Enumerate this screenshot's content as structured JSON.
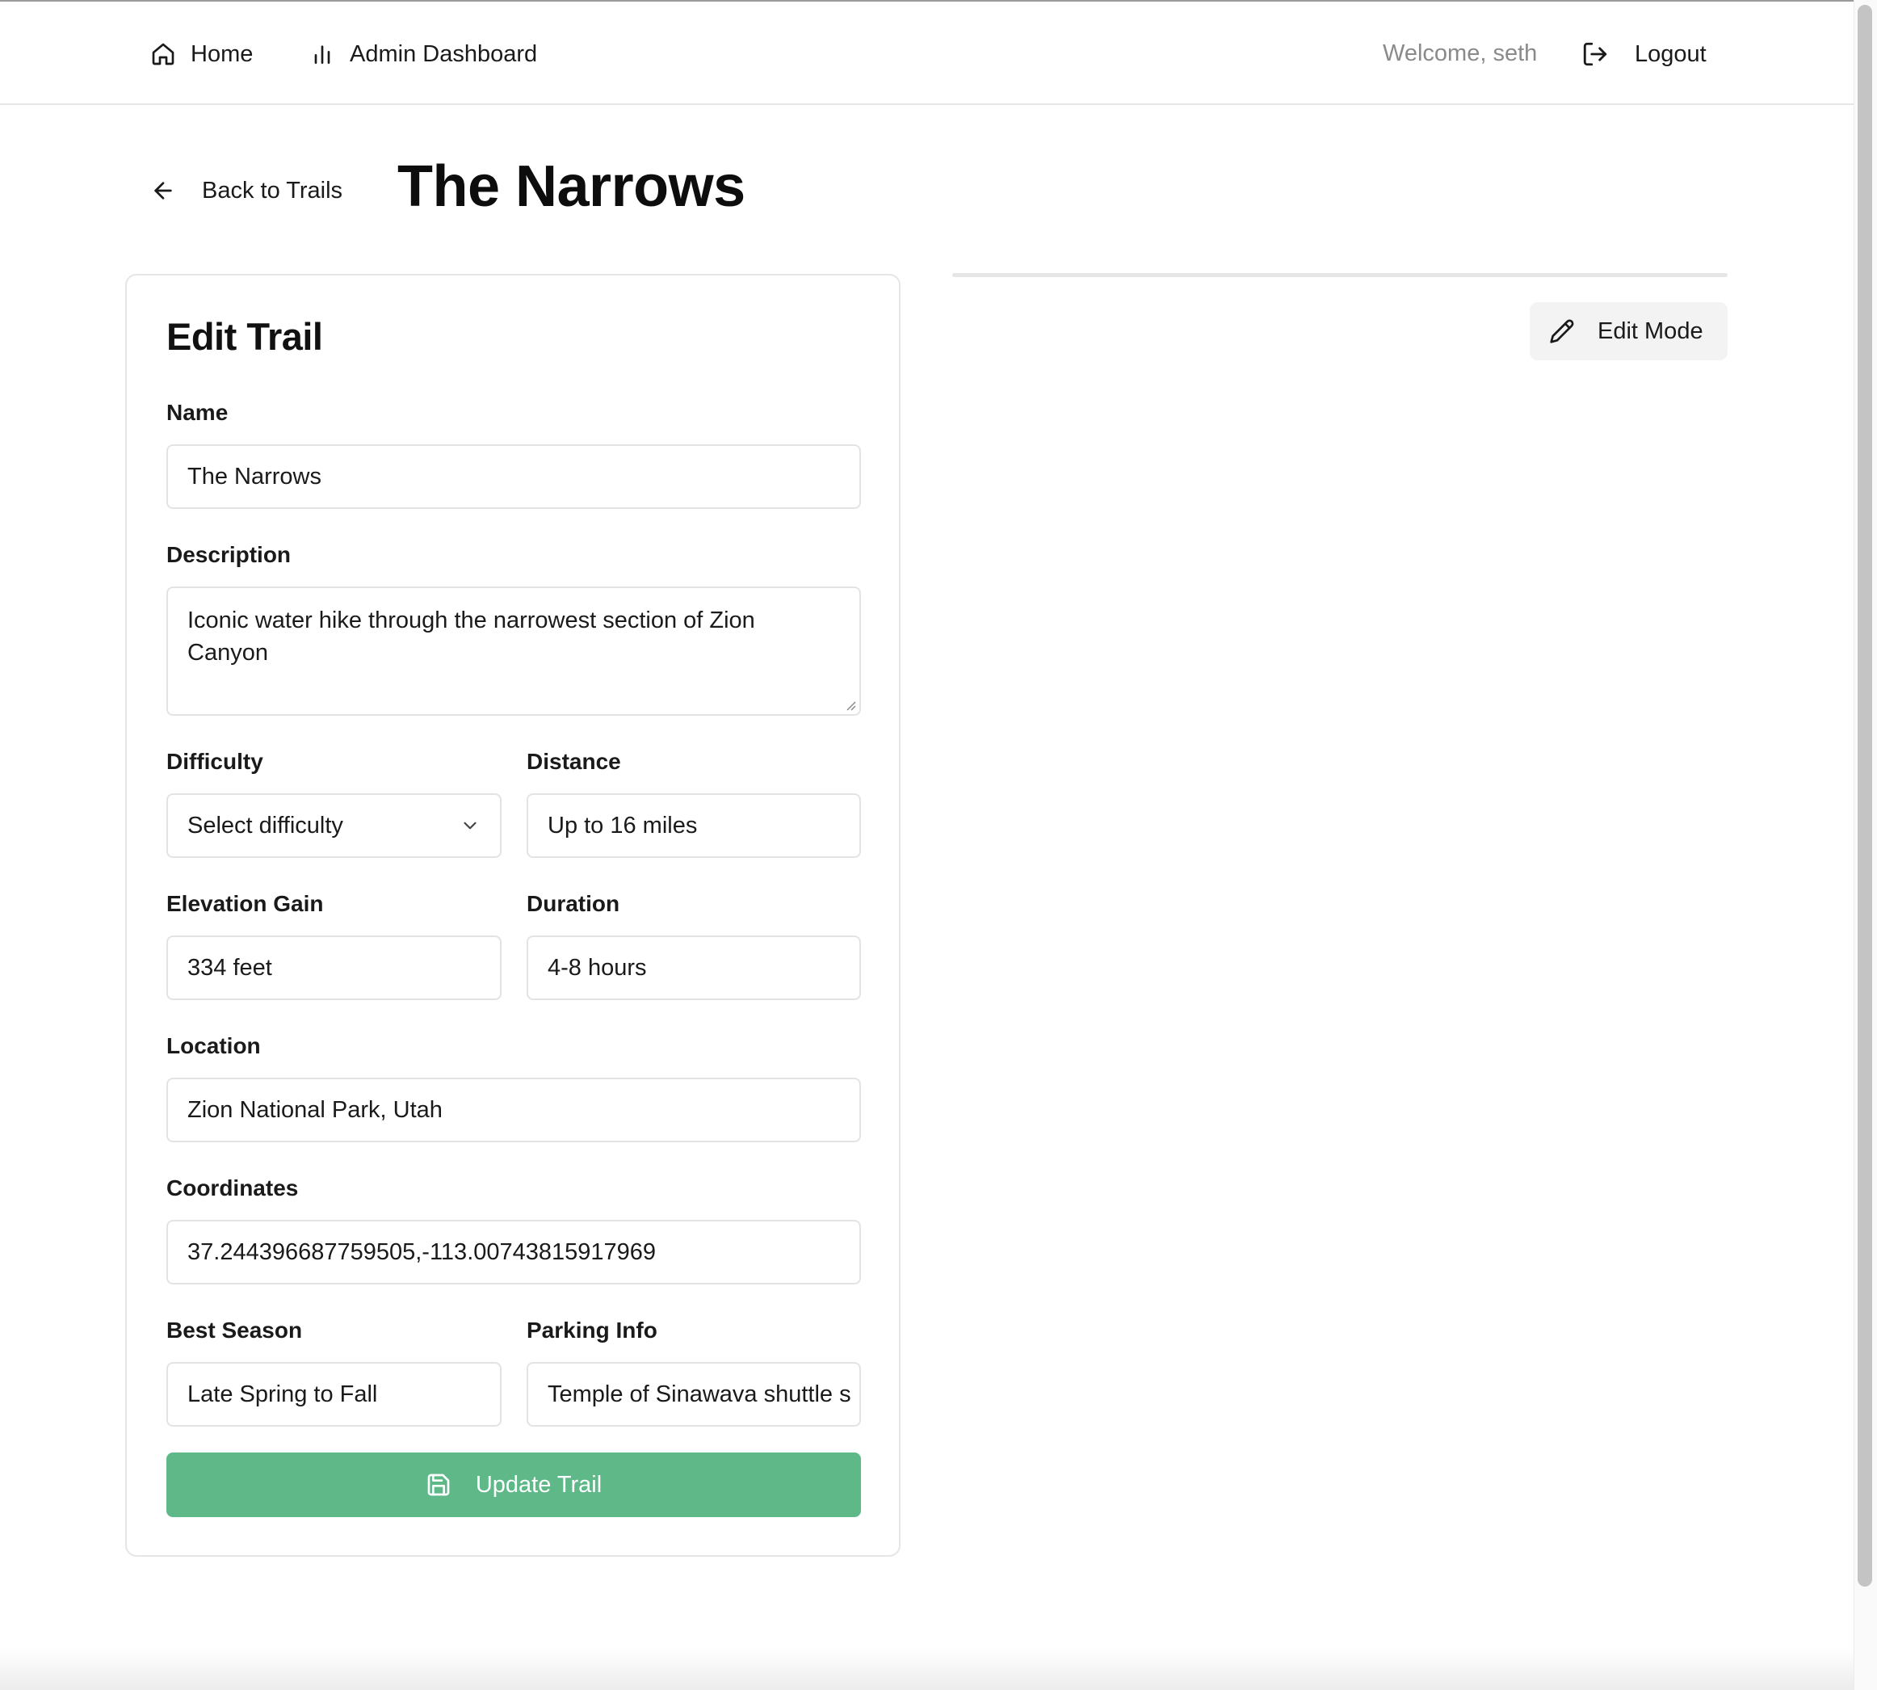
{
  "nav": {
    "home_label": "Home",
    "admin_label": "Admin Dashboard",
    "welcome_text": "Welcome, seth",
    "logout_label": "Logout"
  },
  "header": {
    "back_label": "Back to Trails",
    "title": "The Narrows"
  },
  "form": {
    "title": "Edit Trail",
    "name_label": "Name",
    "name_value": "The Narrows",
    "description_label": "Description",
    "description_value": "Iconic water hike through the narrowest section of Zion Canyon",
    "difficulty_label": "Difficulty",
    "difficulty_placeholder": "Select difficulty",
    "distance_label": "Distance",
    "distance_value": "Up to 16 miles",
    "elevation_label": "Elevation Gain",
    "elevation_value": "334 feet",
    "duration_label": "Duration",
    "duration_value": "4-8 hours",
    "location_label": "Location",
    "location_value": "Zion National Park, Utah",
    "coordinates_label": "Coordinates",
    "coordinates_value": "37.244396687759505,-113.00743815917969",
    "season_label": "Best Season",
    "season_value": "Late Spring to Fall",
    "parking_label": "Parking Info",
    "parking_value": "Temple of Sinawava shuttle s",
    "submit_label": "Update Trail"
  },
  "side": {
    "edit_mode_label": "Edit Mode"
  },
  "colors": {
    "accent_green": "#5eb888",
    "muted_text": "#8a8a8a",
    "border": "#e3e3e3"
  },
  "icons": {
    "home": "home-icon",
    "admin": "bar-chart-icon",
    "logout": "logout-icon",
    "back": "arrow-left-icon",
    "select": "chevron-down-icon",
    "save": "save-icon",
    "edit": "pencil-icon"
  }
}
